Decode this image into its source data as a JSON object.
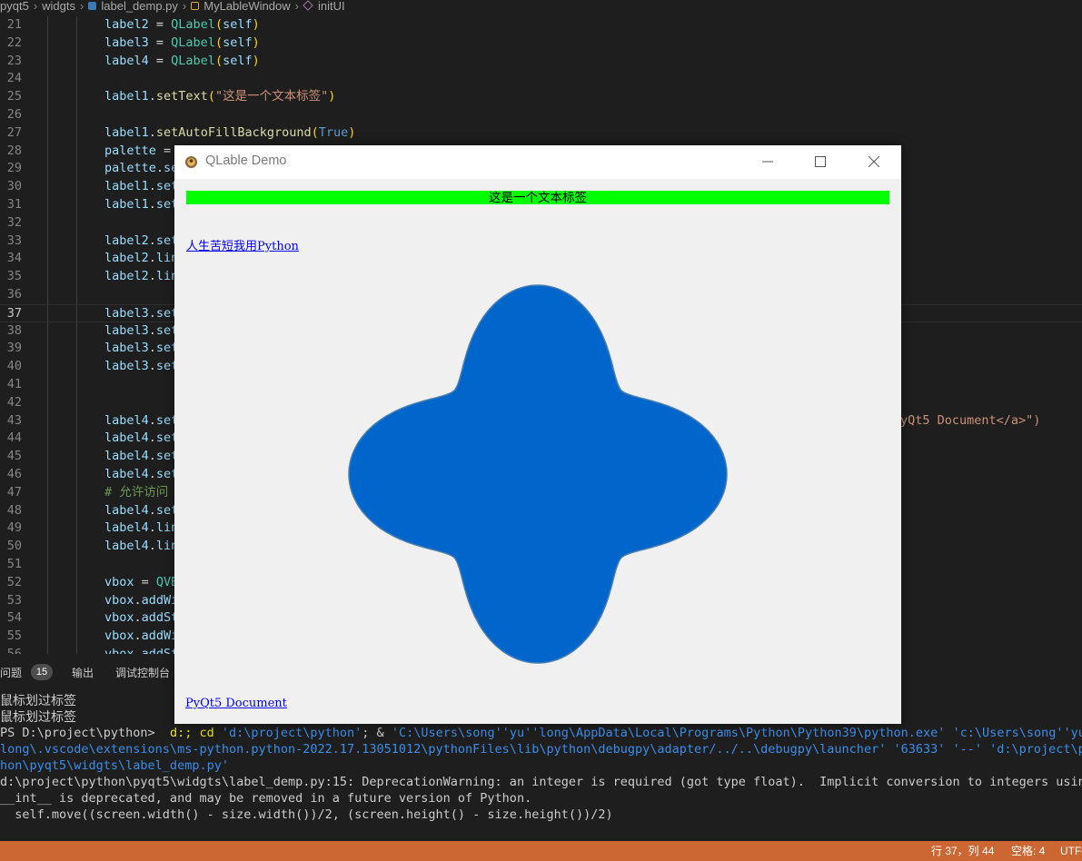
{
  "breadcrumb": {
    "items": [
      "pyqt5",
      "widgts",
      "label_demp.py",
      "MyLableWindow",
      "initUI"
    ]
  },
  "editor": {
    "active_line": 37,
    "lines": [
      {
        "n": "21",
        "code": "label2 = QLabel(self)"
      },
      {
        "n": "22",
        "code": "label3 = QLabel(self)"
      },
      {
        "n": "23",
        "code": "label4 = QLabel(self)"
      },
      {
        "n": "24",
        "code": ""
      },
      {
        "n": "25",
        "code": "label1.setText(\"这是一个文本标签\")"
      },
      {
        "n": "26",
        "code": ""
      },
      {
        "n": "27",
        "code": "label1.setAutoFillBackground(True)"
      },
      {
        "n": "28",
        "code": "palette = "
      },
      {
        "n": "29",
        "code": "palette.se"
      },
      {
        "n": "30",
        "code": "label1.set"
      },
      {
        "n": "31",
        "code": "label1.set"
      },
      {
        "n": "32",
        "code": ""
      },
      {
        "n": "33",
        "code": "label2.set"
      },
      {
        "n": "34",
        "code": "label2.lin"
      },
      {
        "n": "35",
        "code": "label2.lin"
      },
      {
        "n": "36",
        "code": ""
      },
      {
        "n": "37",
        "code": "label3.set"
      },
      {
        "n": "38",
        "code": "label3.set"
      },
      {
        "n": "39",
        "code": "label3.set"
      },
      {
        "n": "40",
        "code": "label3.set"
      },
      {
        "n": "41",
        "code": ""
      },
      {
        "n": "42",
        "code": ""
      },
      {
        "n": "43",
        "code": "label4.set",
        "tail": "yQt5 Document</a>\")"
      },
      {
        "n": "44",
        "code": "label4.set"
      },
      {
        "n": "45",
        "code": "label4.set"
      },
      {
        "n": "46",
        "code": "label4.set"
      },
      {
        "n": "47",
        "code": "# 允许访问"
      },
      {
        "n": "48",
        "code": "label4.set"
      },
      {
        "n": "49",
        "code": "label4.lin"
      },
      {
        "n": "50",
        "code": "label4.lin"
      },
      {
        "n": "51",
        "code": ""
      },
      {
        "n": "52",
        "code": "vbox = QVB"
      },
      {
        "n": "53",
        "code": "vbox.addWi"
      },
      {
        "n": "54",
        "code": "vbox.addSt"
      },
      {
        "n": "55",
        "code": "vbox.addWi"
      },
      {
        "n": "56",
        "code": "vbox.addSt"
      }
    ]
  },
  "panel": {
    "tabs": [
      {
        "label": "问题",
        "badge": "15"
      },
      {
        "label": "输出"
      },
      {
        "label": "调试控制台"
      }
    ]
  },
  "terminal": {
    "lines": [
      "鼠标划过标签",
      "鼠标划过标签",
      "PS D:\\project\\python>  d:; cd 'd:\\project\\python'; & 'C:\\Users\\song''yu''long\\AppData\\Local\\Programs\\Python\\Python39\\python.exe' 'c:\\Users\\song''yu''",
      "long\\.vscode\\extensions\\ms-python.python-2022.17.13051012\\pythonFiles\\lib\\python\\debugpy\\adapter/../..\\debugpy\\launcher' '63633' '--' 'd:\\project\\pyt",
      "hon\\pyqt5\\widgts\\label_demp.py'",
      "d:\\project\\python\\pyqt5\\widgts\\label_demp.py:15: DeprecationWarning: an integer is required (got type float).  Implicit conversion to integers using",
      "__int__ is deprecated, and may be removed in a future version of Python.",
      "  self.move((screen.width() - size.width())/2, (screen.height() - size.height())/2)"
    ]
  },
  "statusbar": {
    "position": "行 37，列 44",
    "indent": "空格: 4",
    "encoding": "UTF-"
  },
  "qt_window": {
    "title": "QLable Demo",
    "label1_text": "这是一个文本标签",
    "label1_bg": "#00ff00",
    "link1_text": "人生苦短我用Python",
    "link2_text": "PyQt5 Document",
    "link_color": "#0000ff",
    "shape_color": "#0066cc",
    "icon": "python-app-icon"
  },
  "colors": {
    "editor_bg": "#1e1e1e",
    "statusbar_bg": "#cc6633",
    "qt_bg": "#f0f0f0"
  }
}
